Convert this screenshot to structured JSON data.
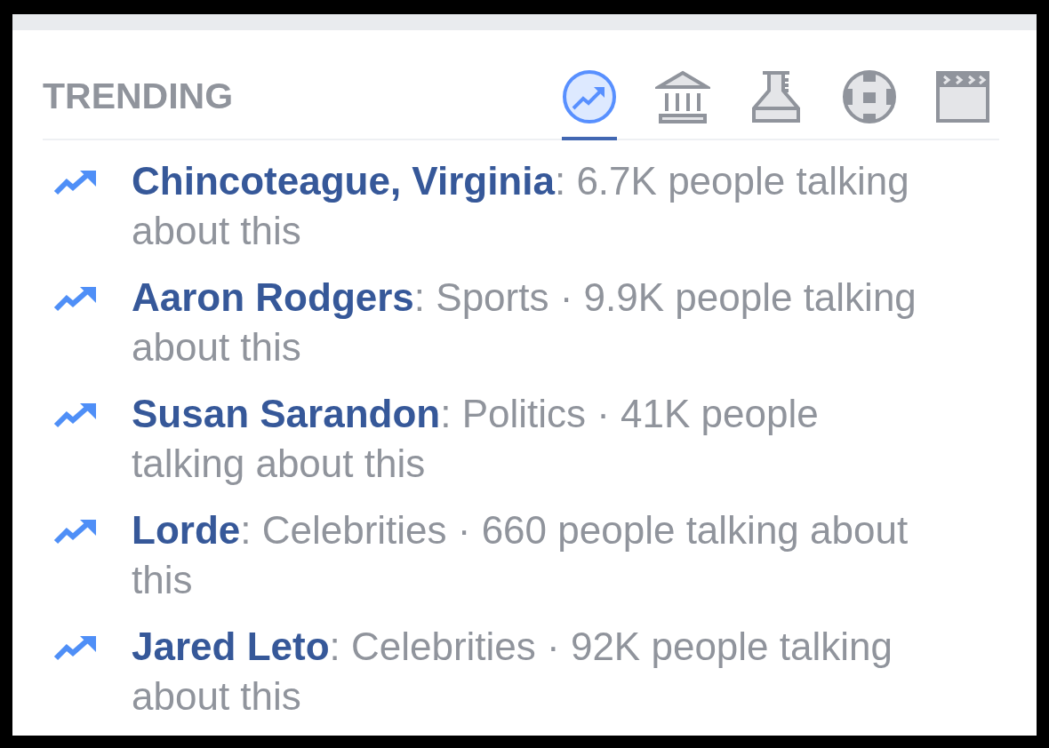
{
  "header": {
    "title": "TRENDING"
  },
  "tabs": [
    {
      "kind": "trending",
      "selected": true
    },
    {
      "kind": "politics",
      "selected": false
    },
    {
      "kind": "science",
      "selected": false
    },
    {
      "kind": "sports",
      "selected": false
    },
    {
      "kind": "entertainment",
      "selected": false
    }
  ],
  "trends": [
    {
      "topic": "Chincoteague, Virginia",
      "detail": ": 6.7K people talking about this"
    },
    {
      "topic": "Aaron Rodgers",
      "detail": ": Sports · 9.9K people talking about this"
    },
    {
      "topic": "Susan Sarandon",
      "detail": ": Politics · 41K people talking about this"
    },
    {
      "topic": "Lorde",
      "detail": ": Celebrities · 660 people talking about this"
    },
    {
      "topic": "Jared Leto",
      "detail": ": Celebrities · 92K people talking about this"
    }
  ]
}
